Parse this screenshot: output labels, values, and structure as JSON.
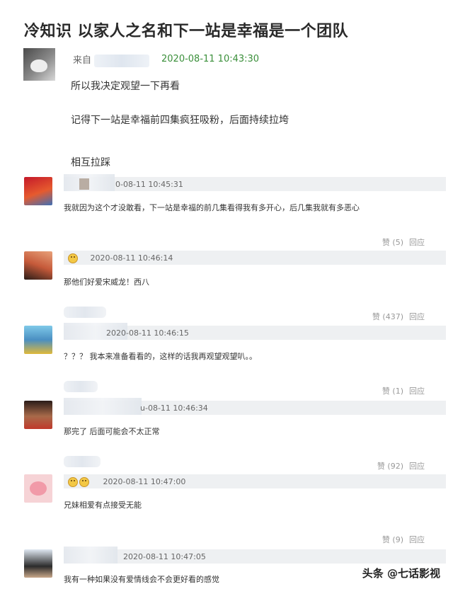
{
  "page": {
    "title": "冷知识 以家人之名和下一站是幸福是一个团队"
  },
  "post": {
    "from_label": "来自",
    "time": "2020-08-11 10:43:30",
    "lines": [
      "所以我决定观望一下再看",
      "记得下一站是幸福前四集疯狂吸粉，后面持续拉垮",
      "相互拉踩"
    ]
  },
  "comments": [
    {
      "time": "0-08-11 10:45:31",
      "text": "我就因为这个才没敢看，下一站是幸福的前几集看得我有多开心，后几集我就有多恶心",
      "likes": "赞 (5)",
      "reply": "回应"
    },
    {
      "time": "2020-08-11 10:46:14",
      "text": "那他们好爱宋威龙！西八",
      "likes": "赞 (437)",
      "reply": "回应"
    },
    {
      "time": "2020-08-11 10:46:15",
      "text": "？？？ 我本来准备看看的，这样的话我再观望观望叭。。",
      "likes": "赞 (1)",
      "reply": "回应"
    },
    {
      "time": "u-08-11 10:46:34",
      "text": "那完了 后面可能会不太正常",
      "likes": "赞 (92)",
      "reply": "回应"
    },
    {
      "time": "2020-08-11 10:47:00",
      "text": "兄妹相爱有点接受无能",
      "likes": "赞 (9)",
      "reply": "回应"
    },
    {
      "time": "2020-08-11 10:47:05",
      "text": "我有一种如果没有爱情线会不会更好看的感觉",
      "likes": "",
      "reply": ""
    }
  ],
  "icons": {
    "emoji": "grinning-face-icon"
  },
  "colors": {
    "post_time": "#3a8f3a",
    "meta_bar": "#eef0f2"
  },
  "watermark": "头条 @七话影视"
}
